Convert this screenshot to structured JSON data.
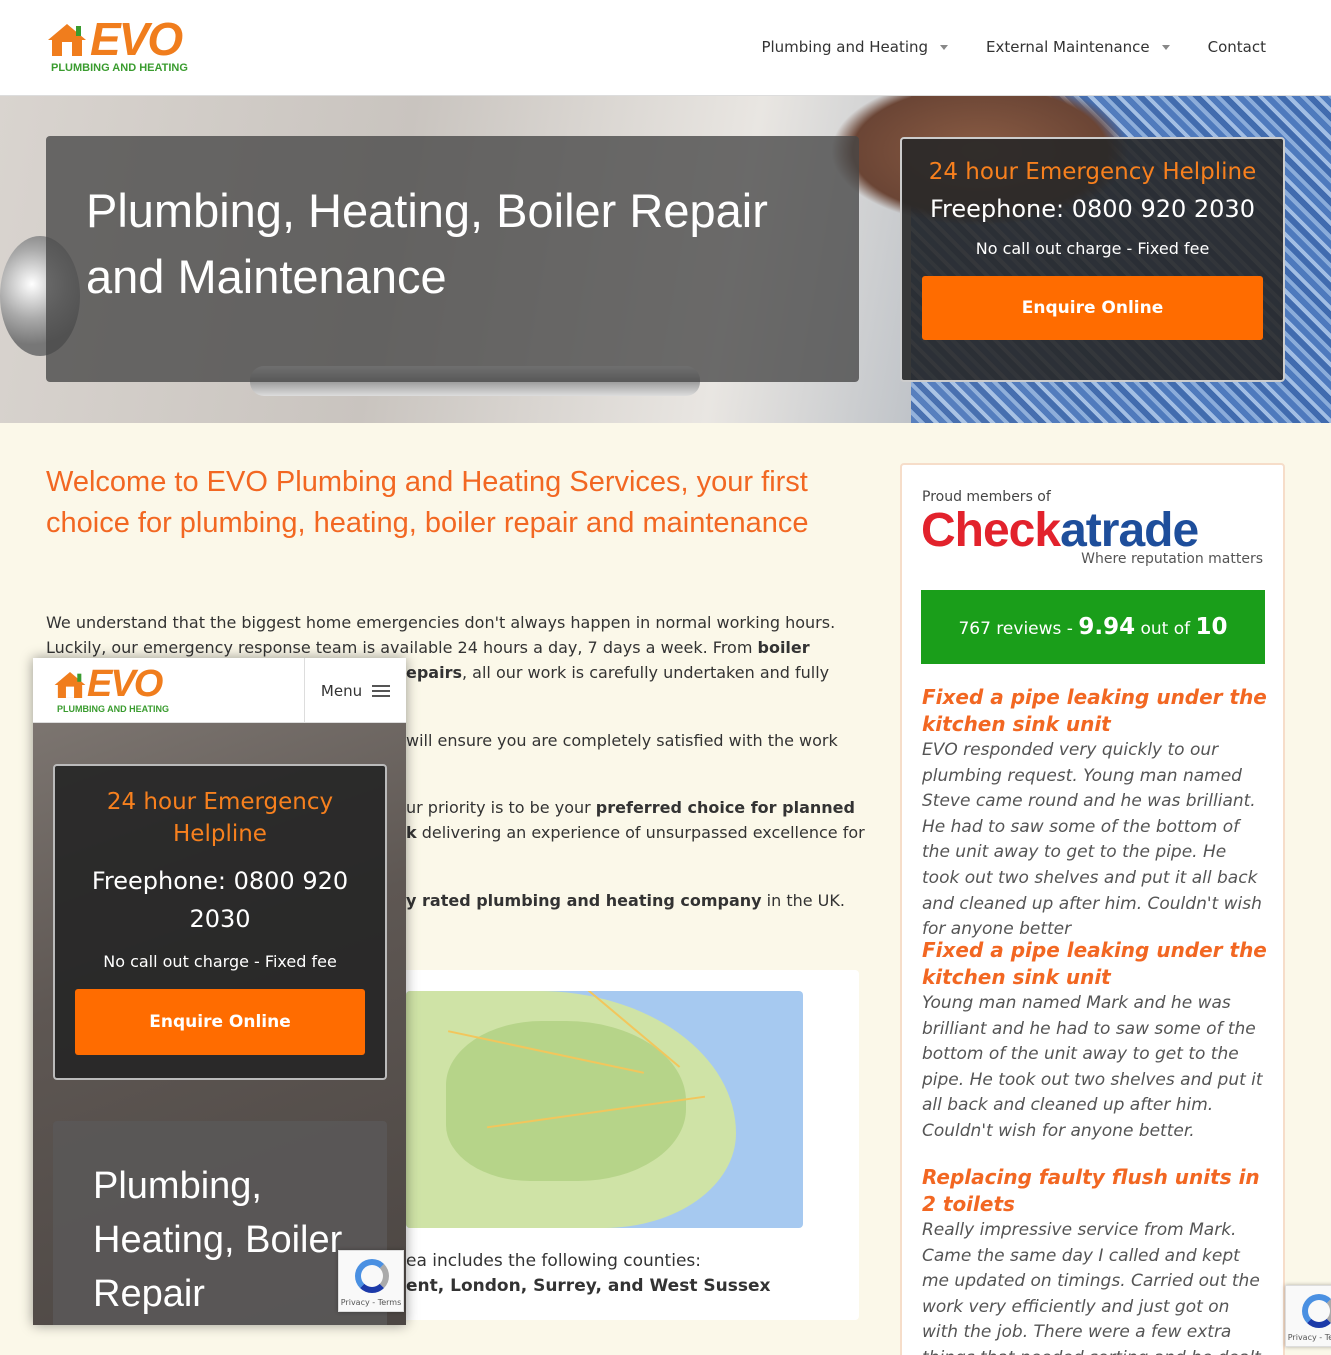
{
  "header": {
    "logo_text": "EVO",
    "logo_sub": "PLUMBING AND HEATING",
    "nav": [
      {
        "label": "Plumbing and Heating",
        "dropdown": true
      },
      {
        "label": "External Maintenance",
        "dropdown": true
      },
      {
        "label": "Contact",
        "dropdown": false
      }
    ]
  },
  "hero": {
    "title": "Plumbing, Heating, Boiler Repair and Maintenance"
  },
  "helpline": {
    "title": "24 hour Emergency Helpline",
    "phone": "Freephone: 0800 920 2030",
    "note": "No call out charge - Fixed fee",
    "button": "Enquire Online"
  },
  "main": {
    "welcome": "Welcome to EVO Plumbing and Heating Services, your first choice for plumbing, heating, boiler repair and maintenance",
    "p1_a": "We understand that the biggest home emergencies don't always happen in normal working hours. Luckily, our emergency response team is available 24 hours a day, 7 days a week. From ",
    "p1_b": "boiler",
    "p1_c": "epairs",
    "p1_d": ", all our work is carefully undertaken and fully",
    "p2": "will ensure you are completely satisfied with the work",
    "p3_a": "ur priority is to be your ",
    "p3_b": "preferred choice for planned",
    "p3_c": "k",
    "p3_d": " delivering an experience of unsurpassed excellence for",
    "p4_a": "y rated plumbing and heating company",
    "p4_b": " in the UK.",
    "area_line1": "ea includes the following counties:",
    "area_line2": "ent, London, Surrey, and West Sussex"
  },
  "sidebar": {
    "proud": "Proud members of",
    "ct_red": "Check",
    "ct_blue": "atrade",
    "ct_tag": "Where reputation matters",
    "reviews_count": "767 reviews - ",
    "score": "9.94",
    "out_of": " out of ",
    "max": "10",
    "reviews": [
      {
        "title": "Fixed a pipe leaking under the kitchen sink unit",
        "body": "EVO responded very quickly to our plumbing request. Young man named Steve came round and he was brilliant. He had to saw some of the bottom of the unit away to get to the pipe. He took out two shelves and put it all back and cleaned up after him. Couldn't wish for anyone better"
      },
      {
        "title": "Fixed a pipe leaking under the kitchen sink unit",
        "body": "Young man named Mark and he was brilliant and he had to saw some of the bottom of the unit away to get to the pipe. He took out two shelves and put it all back and cleaned up after him. Couldn't wish for anyone better."
      },
      {
        "title": "Replacing faulty flush units in 2 toilets",
        "body": "Really impressive service from Mark. Came the same day I called and kept me updated on timings. Carried out the work very efficiently and just got on with the job. There were a few extra things that needed sorting and he dealt with"
      }
    ]
  },
  "mobile": {
    "menu": "Menu",
    "hero_title": "Plumbing, Heating, Boiler Repair"
  },
  "recaptcha": {
    "label": "Privacy - Terms"
  },
  "colors": {
    "accent": "#f26722",
    "button": "#ff6c00",
    "checkatrade_red": "#e2222c",
    "checkatrade_blue": "#1e4e9b",
    "score_green": "#1a9e1a"
  }
}
